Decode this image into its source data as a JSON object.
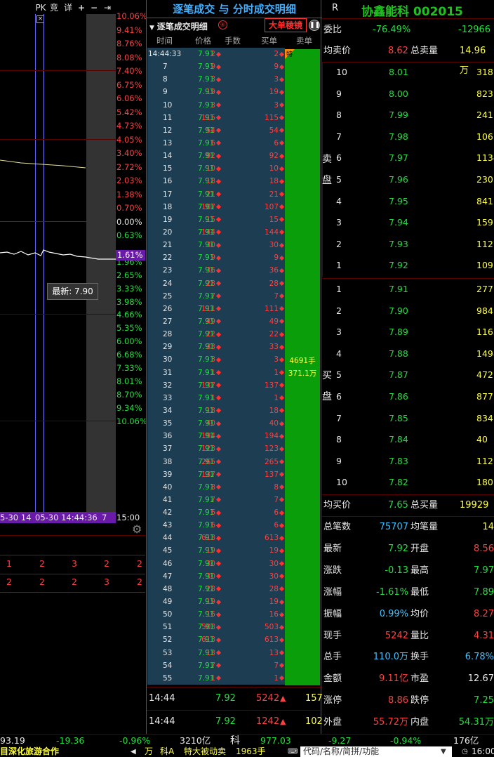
{
  "chart": {
    "toolbar": [
      "PK",
      "竞",
      "详"
    ],
    "pct_labels_up": [
      "10.06%",
      "9.41%",
      "8.76%",
      "8.08%",
      "7.40%",
      "6.75%",
      "6.06%",
      "5.42%",
      "4.73%",
      "4.05%",
      "3.40%",
      "2.72%",
      "2.03%",
      "1.38%",
      "0.70%"
    ],
    "zero_label": "0.00%",
    "pct_labels_down": [
      "0.63%",
      "1.29%",
      "1.96%",
      "2.65%",
      "3.33%",
      "3.98%",
      "4.66%",
      "5.35%",
      "6.00%",
      "6.68%",
      "7.33%",
      "8.01%",
      "8.70%",
      "9.34%",
      "10.06%"
    ],
    "current_pct": "1.61%",
    "tooltip": "最新: 7.90",
    "time_start": "5-30 14",
    "time_cursor": "05-30 14:44:36",
    "time_suffix": "7",
    "time_end": "15:00",
    "grid_rows": [
      [
        "1",
        "2",
        "3",
        "2",
        "2"
      ],
      [
        "2",
        "2",
        "2",
        "3",
        "2"
      ]
    ]
  },
  "ticks": {
    "title": "逐笔成交 与 分时成交明细",
    "dropdown": "逐笔成交明细",
    "badge_label": "大单稜镜",
    "columns": [
      "时间",
      "价格",
      "手数",
      "买单",
      "卖单"
    ],
    "rows": [
      [
        "14:44:33",
        "7.91",
        "2",
        "2"
      ],
      [
        "7",
        "7.91",
        "9",
        "9"
      ],
      [
        "8",
        "7.91",
        "3",
        "3"
      ],
      [
        "9",
        "7.91",
        "19",
        "19"
      ],
      [
        "10",
        "7.91",
        "3",
        "3"
      ],
      [
        "11",
        "7.91",
        "115",
        "115"
      ],
      [
        "12",
        "7.91",
        "54",
        "54"
      ],
      [
        "13",
        "7.91",
        "6",
        "6"
      ],
      [
        "14",
        "7.91",
        "92",
        "92"
      ],
      [
        "15",
        "7.91",
        "10",
        "10"
      ],
      [
        "16",
        "7.91",
        "18",
        "18"
      ],
      [
        "17",
        "7.91",
        "21",
        "21"
      ],
      [
        "18",
        "7.91",
        "107",
        "107"
      ],
      [
        "19",
        "7.91",
        "15",
        "15"
      ],
      [
        "20",
        "7.91",
        "144",
        "144"
      ],
      [
        "21",
        "7.91",
        "30",
        "30"
      ],
      [
        "22",
        "7.91",
        "9",
        "9"
      ],
      [
        "23",
        "7.91",
        "36",
        "36"
      ],
      [
        "24",
        "7.91",
        "28",
        "28"
      ],
      [
        "25",
        "7.91",
        "7",
        "7"
      ],
      [
        "26",
        "7.91",
        "111",
        "111"
      ],
      [
        "27",
        "7.91",
        "49",
        "49"
      ],
      [
        "28",
        "7.91",
        "22",
        "22"
      ],
      [
        "29",
        "7.91",
        "33",
        "33"
      ],
      [
        "30",
        "7.91",
        "3",
        "3"
      ],
      [
        "31",
        "7.91",
        "1",
        "1"
      ],
      [
        "32",
        "7.91",
        "137",
        "137"
      ],
      [
        "33",
        "7.91",
        "1",
        "1"
      ],
      [
        "34",
        "7.91",
        "18",
        "18"
      ],
      [
        "35",
        "7.91",
        "40",
        "40"
      ],
      [
        "36",
        "7.91",
        "194",
        "194"
      ],
      [
        "37",
        "7.91",
        "123",
        "123"
      ],
      [
        "38",
        "7.91",
        "265",
        "265"
      ],
      [
        "39",
        "7.91",
        "137",
        "137"
      ],
      [
        "40",
        "7.91",
        "8",
        "8"
      ],
      [
        "41",
        "7.91",
        "7",
        "7"
      ],
      [
        "42",
        "7.91",
        "6",
        "6"
      ],
      [
        "43",
        "7.91",
        "6",
        "6"
      ],
      [
        "44",
        "7.91",
        "613",
        "613"
      ],
      [
        "45",
        "7.91",
        "19",
        "19"
      ],
      [
        "46",
        "7.91",
        "30",
        "30"
      ],
      [
        "47",
        "7.91",
        "30",
        "30"
      ],
      [
        "48",
        "7.91",
        "28",
        "28"
      ],
      [
        "49",
        "7.91",
        "19",
        "19"
      ],
      [
        "50",
        "7.91",
        "16",
        "16"
      ],
      [
        "51",
        "7.91",
        "503",
        "503"
      ],
      [
        "52",
        "7.91",
        "613",
        "613"
      ],
      [
        "53",
        "7.91",
        "13",
        "13"
      ],
      [
        "54",
        "7.91",
        "7",
        "7"
      ],
      [
        "55",
        "7.91",
        "1",
        "1"
      ]
    ],
    "first_row_tag": "特",
    "sell_total_hands": "4691手",
    "sell_total_amount": "371.1万",
    "summary": [
      {
        "time": "14:44",
        "price": "7.92",
        "hands": "5242",
        "extra": "157"
      },
      {
        "time": "14:44",
        "price": "7.92",
        "hands": "1242",
        "extra": "102"
      }
    ]
  },
  "header": {
    "r_label": "R",
    "stock_name": "协鑫能科 002015"
  },
  "quote": {
    "weibi_label": "委比",
    "weibi_pct": "-76.49%",
    "weibi_diff": "-12966",
    "avg_sell_label": "均卖价",
    "avg_sell": "8.62",
    "total_sell_label": "总卖量",
    "total_sell": "14.96万",
    "sell_side_label": [
      "卖",
      "盘"
    ],
    "asks": [
      [
        "10",
        "8.01",
        "318"
      ],
      [
        "9",
        "8.00",
        "823"
      ],
      [
        "8",
        "7.99",
        "241"
      ],
      [
        "7",
        "7.98",
        "106"
      ],
      [
        "6",
        "7.97",
        "1134"
      ],
      [
        "5",
        "7.96",
        "230"
      ],
      [
        "4",
        "7.95",
        "841"
      ],
      [
        "3",
        "7.94",
        "159"
      ],
      [
        "2",
        "7.93",
        "1127"
      ],
      [
        "1",
        "7.92",
        "1091"
      ]
    ],
    "buy_side_label": [
      "买",
      "盘"
    ],
    "bids": [
      [
        "1",
        "7.91",
        "277"
      ],
      [
        "2",
        "7.90",
        "984"
      ],
      [
        "3",
        "7.89",
        "1163"
      ],
      [
        "4",
        "7.88",
        "1498"
      ],
      [
        "5",
        "7.87",
        "472"
      ],
      [
        "6",
        "7.86",
        "877"
      ],
      [
        "7",
        "7.85",
        "834"
      ],
      [
        "8",
        "7.84",
        "40"
      ],
      [
        "9",
        "7.83",
        "112"
      ],
      [
        "10",
        "7.82",
        "180"
      ]
    ],
    "avg_buy_label": "均买价",
    "avg_buy": "7.65",
    "total_buy_label": "总买量",
    "total_buy": "19929",
    "stats": [
      [
        "总笔数",
        "75707",
        "均笔量",
        "14"
      ],
      [
        "最新",
        "7.92",
        "开盘",
        "8.56"
      ],
      [
        "涨跌",
        "-0.13",
        "最高",
        "7.97"
      ],
      [
        "涨幅",
        "-1.61%",
        "最低",
        "7.89"
      ],
      [
        "振幅",
        "0.99%",
        "均价",
        "8.27"
      ],
      [
        "现手",
        "5242",
        "量比",
        "4.31"
      ],
      [
        "总手",
        "110.0万",
        "换手",
        "6.78%"
      ],
      [
        "金额",
        "9.11亿",
        "市盈",
        "12.67"
      ],
      [
        "涨停",
        "8.86",
        "跌停",
        "7.25"
      ],
      [
        "外盘",
        "55.72万",
        "内盘",
        "54.31万"
      ]
    ]
  },
  "ticker": {
    "sh_value": "93.19",
    "sh_change": "-19.36",
    "sh_pct": "-0.96%",
    "sh_amount": "3210亿",
    "ke_label": "科",
    "ke_value": "977.03",
    "ke_change": "-9.27",
    "ke_pct": "-0.94%",
    "ke_amount": "176亿"
  },
  "status": {
    "news": "目深化旅游合作",
    "alert_prefix": "万",
    "alert_stock": "科A",
    "alert_kind": "特大被动卖",
    "alert_qty": "1963手",
    "search_placeholder": "代码/名称/简拼/功能",
    "clock": "16:00:06"
  }
}
